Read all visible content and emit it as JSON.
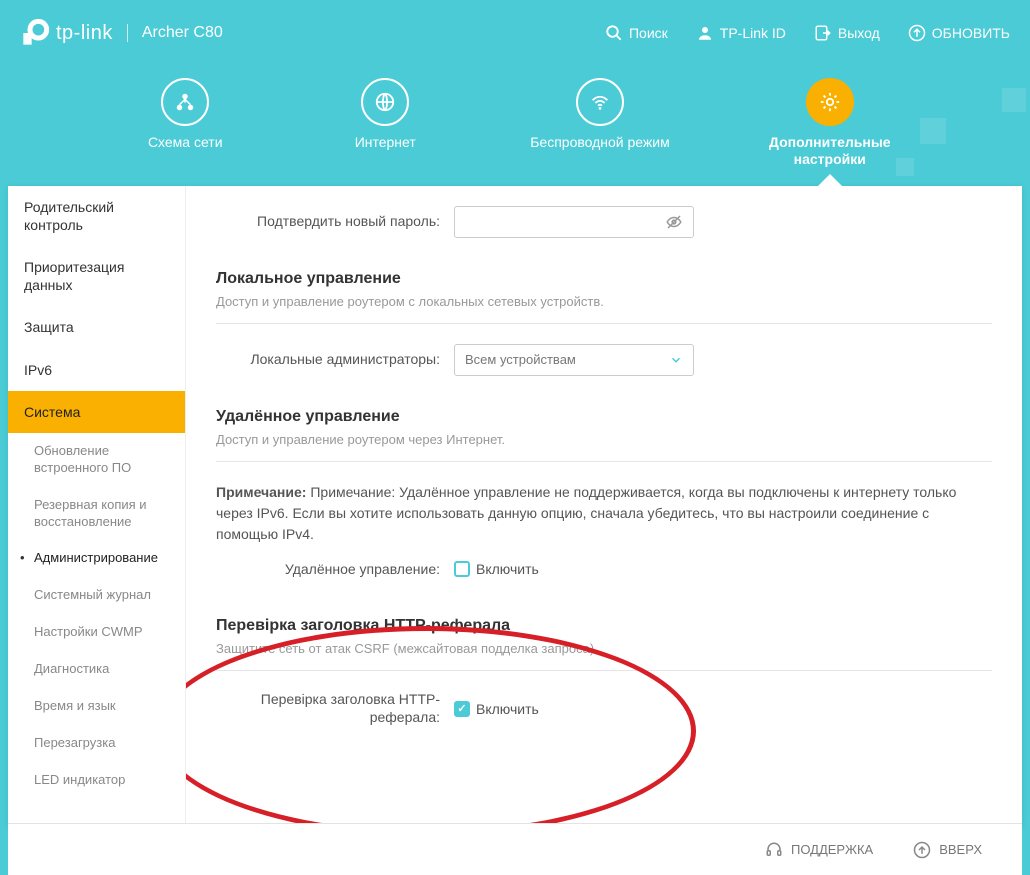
{
  "brand": {
    "logo": "tp-link",
    "model": "Archer C80"
  },
  "toplinks": {
    "search": "Поиск",
    "tplinkid": "TP-Link ID",
    "logout": "Выход",
    "update": "ОБНОВИТЬ"
  },
  "nav": {
    "network": "Схема сети",
    "internet": "Интернет",
    "wireless": "Беспроводной режим",
    "advanced": "Дополнительные настройки"
  },
  "sidebar": {
    "items": [
      "Родительский контроль",
      "Приоритезация данных",
      "Защита",
      "IPv6",
      "Система"
    ],
    "subitems": [
      "Обновление встроенного ПО",
      "Резервная копия и восстановление",
      "Администрирование",
      "Системный журнал",
      "Настройки CWMP",
      "Диагностика",
      "Время и язык",
      "Перезагрузка",
      "LED индикатор"
    ]
  },
  "form": {
    "confirm_pwd_label": "Подтвердить новый пароль:",
    "local_mgmt_title": "Локальное управление",
    "local_mgmt_desc": "Доступ и управление роутером с локальных сетевых устройств.",
    "local_admins_label": "Локальные администраторы:",
    "local_admins_value": "Всем устройствам",
    "remote_mgmt_title": "Удалённое управление",
    "remote_mgmt_desc": "Доступ и управление роутером через Интернет.",
    "notice_bold": "Примечание:",
    "notice_text": " Примечание: Удалённое управление не поддерживается, когда вы подключены к интернету только через IPv6. Если вы хотите использовать данную опцию, сначала убедитесь, что вы настроили соединение с помощью IPv4.",
    "remote_mgmt_label": "Удалённое управление:",
    "enable": "Включить",
    "referer_title": "Перевірка заголовка HTTP-реферала",
    "referer_desc": "Защитите сеть от атак CSRF (межсайтовая подделка запроса).",
    "referer_label": "Перевірка заголовка HTTP-реферала:"
  },
  "footer": {
    "support": "ПОДДЕРЖКА",
    "up": "ВВЕРХ"
  }
}
